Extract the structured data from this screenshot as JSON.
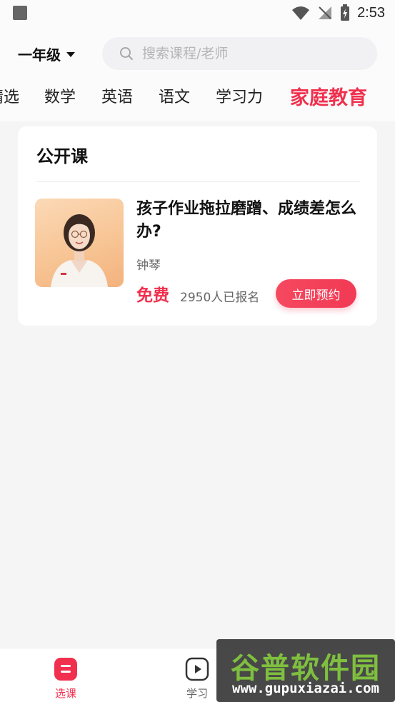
{
  "status_bar": {
    "time": "2:53"
  },
  "header": {
    "grade": "一年级",
    "search_placeholder": "搜索课程/老师"
  },
  "tabs": [
    {
      "label": "精选"
    },
    {
      "label": "数学"
    },
    {
      "label": "英语"
    },
    {
      "label": "语文"
    },
    {
      "label": "学习力"
    },
    {
      "label": "家庭教育",
      "active": true
    }
  ],
  "section": {
    "title": "公开课",
    "course": {
      "title": "孩子作业拖拉磨蹭、成绩差怎么办?",
      "teacher": "钟琴",
      "price": "免费",
      "enrolled": "2950人已报名",
      "button": "立即预约"
    }
  },
  "bottom_nav": [
    {
      "label": "选课",
      "icon": "course-select-icon",
      "active": true
    },
    {
      "label": "学习",
      "icon": "play-icon"
    }
  ],
  "watermark": {
    "title": "谷普软件园",
    "url": "www.gupuxiazai.com"
  },
  "colors": {
    "accent": "#f0304e",
    "background": "#f5f5f5"
  }
}
